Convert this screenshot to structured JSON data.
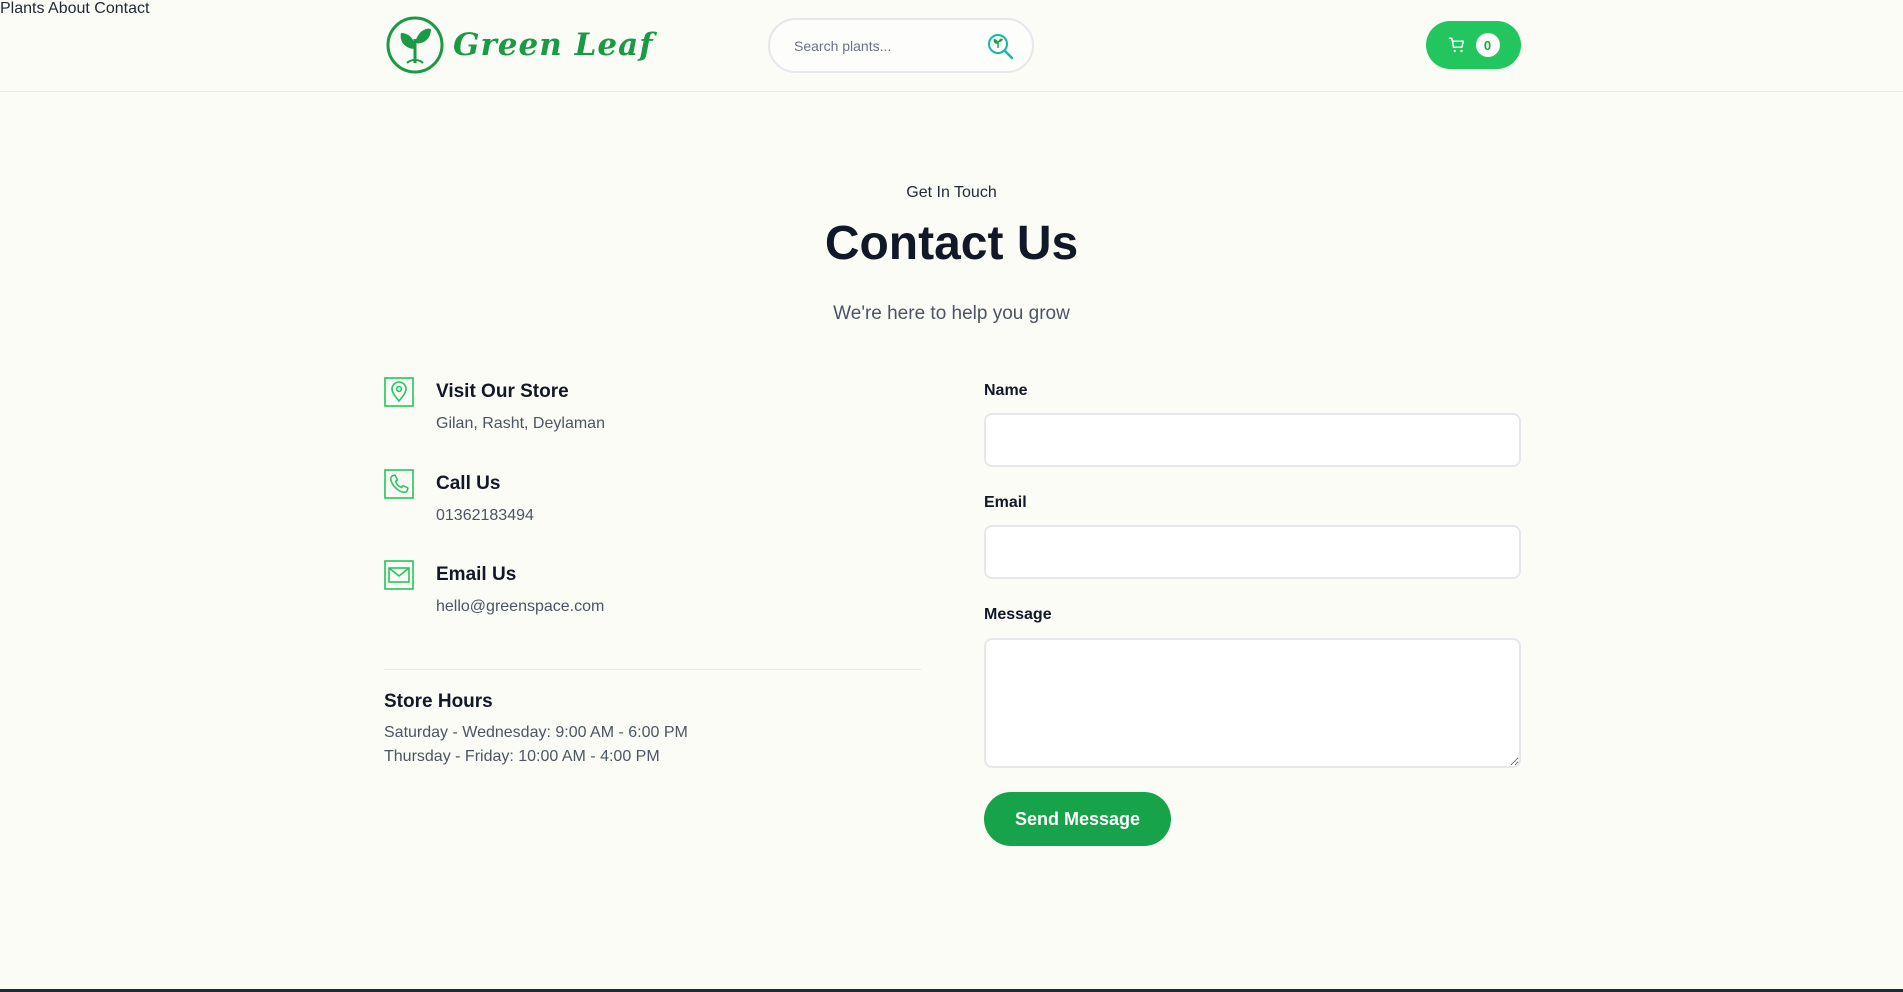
{
  "brand": {
    "name": "Green Leaf",
    "color": "#1a9a45"
  },
  "search": {
    "placeholder": "Search plants..."
  },
  "nav": {
    "items": [
      "Plants",
      "About",
      "Contact"
    ]
  },
  "cart": {
    "count": "0",
    "color": "#22c55e"
  },
  "hero": {
    "eyebrow": "Get In Touch",
    "title": "Contact Us",
    "subtitle": "We're here to help you grow"
  },
  "contact_info": [
    {
      "icon": "map-pin-icon",
      "title": "Visit Our Store",
      "value": "Gilan, Rasht, Deylaman"
    },
    {
      "icon": "phone-icon",
      "title": "Call Us",
      "value": "01362183494"
    },
    {
      "icon": "mail-icon",
      "title": "Email Us",
      "value": "hello@greenspace.com"
    }
  ],
  "store_hours": {
    "title": "Store Hours",
    "lines": [
      "Saturday - Wednesday: 9:00 AM - 6:00 PM",
      "Thursday - Friday: 10:00 AM - 4:00 PM"
    ]
  },
  "form": {
    "name_label": "Name",
    "name_value": "",
    "email_label": "Email",
    "email_value": "",
    "message_label": "Message",
    "message_value": "",
    "submit_label": "Send Message",
    "submit_color": "#16a34a"
  }
}
